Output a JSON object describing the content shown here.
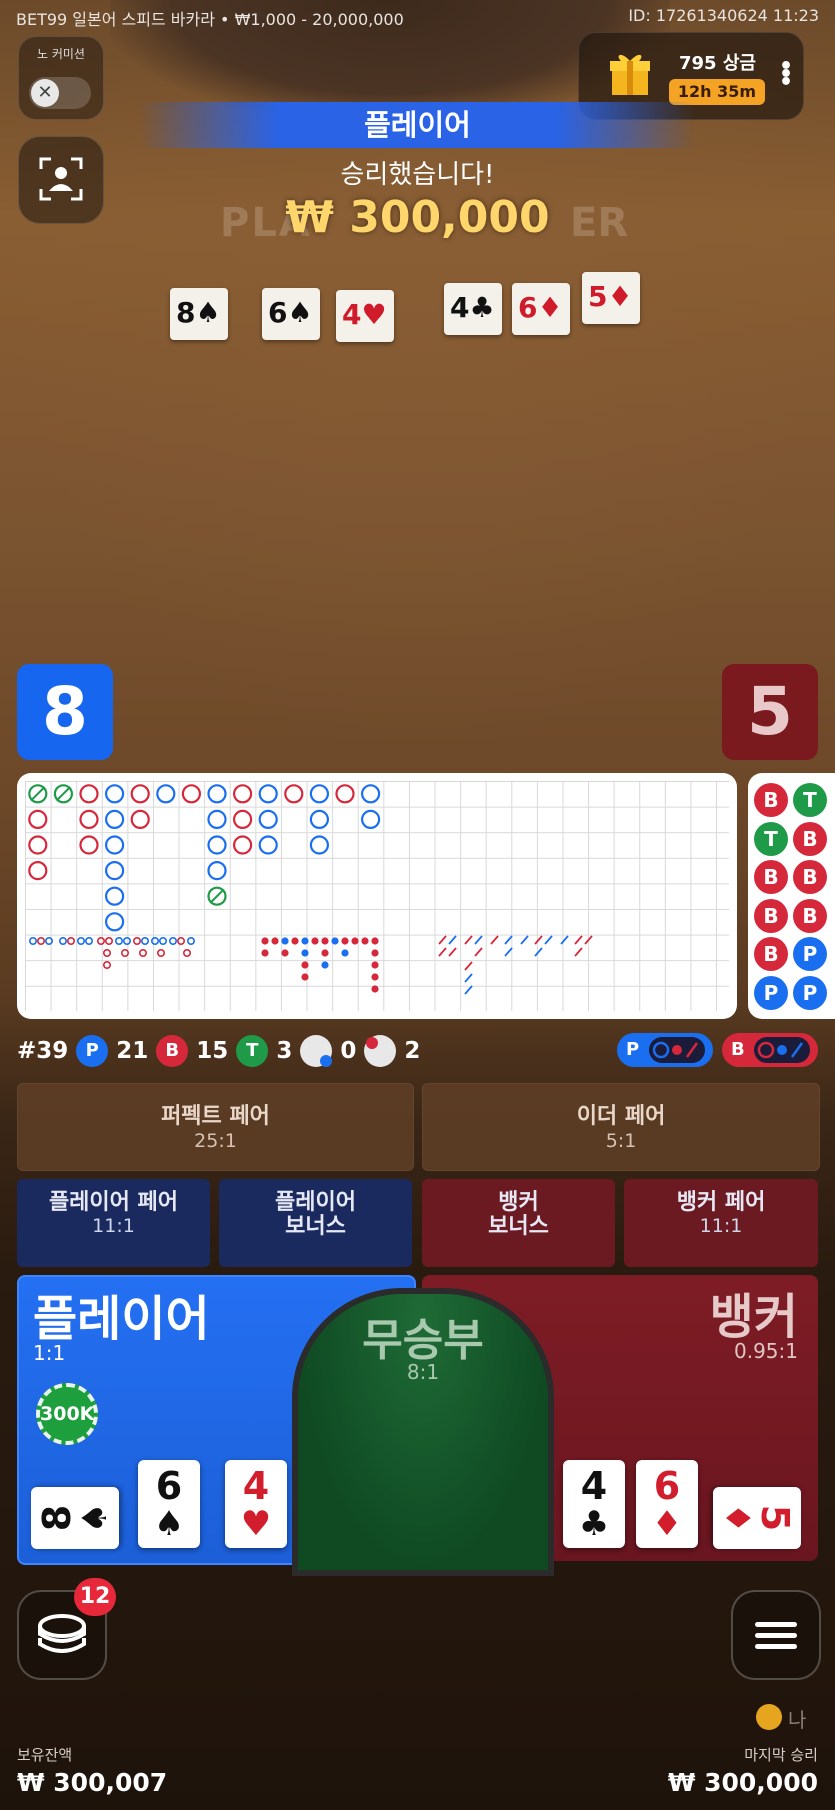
{
  "header": {
    "info": "BET99 일본어 스피드 바카라 • ₩1,000 - 20,000,000",
    "id_time": "ID: 17261340624 11:23"
  },
  "no_commission": {
    "label": "노 커미션"
  },
  "promo": {
    "amount": "795 상금",
    "timer": "12h 35m"
  },
  "result": {
    "banner": "플레이어",
    "subtitle": "승리했습니다!",
    "amount": "₩ 300,000",
    "ghost_left": "PLA",
    "ghost_right": "ER"
  },
  "table_cards": [
    {
      "rank": "8",
      "suit": "♠",
      "color": "#111111"
    },
    {
      "rank": "6",
      "suit": "♠",
      "color": "#111111"
    },
    {
      "rank": "4",
      "suit": "♥",
      "color": "#d01b2b"
    },
    {
      "rank": "4",
      "suit": "♣",
      "color": "#111111"
    },
    {
      "rank": "6",
      "suit": "♦",
      "color": "#d01b2b"
    },
    {
      "rank": "5",
      "suit": "♦",
      "color": "#d01b2b"
    }
  ],
  "scores": {
    "player": "8",
    "banker": "5"
  },
  "stats": {
    "round": "#39",
    "player_letter": "P",
    "player": "21",
    "banker_letter": "B",
    "banker": "15",
    "tie_letter": "T",
    "tie": "3",
    "player_pair": "0",
    "banker_pair": "2"
  },
  "predict": {
    "player": "P",
    "banker": "B"
  },
  "side_road": [
    "B",
    "T",
    "T",
    "B",
    "B",
    "B",
    "B",
    "B",
    "B",
    "P",
    "P",
    "P"
  ],
  "bets": {
    "perfect_pair": {
      "label": "퍼펙트 페어",
      "odds": "25:1"
    },
    "either_pair": {
      "label": "이더 페어",
      "odds": "5:1"
    },
    "player_pair": {
      "label": "플레이어 페어",
      "odds": "11:1"
    },
    "player_bonus": {
      "label1": "플레이어",
      "label2": "보너스"
    },
    "banker_bonus": {
      "label1": "뱅커",
      "label2": "보너스"
    },
    "banker_pair": {
      "label": "뱅커 페어",
      "odds": "11:1"
    },
    "player": {
      "label": "플레이어",
      "odds": "1:1",
      "chip": "300K"
    },
    "tie": {
      "label": "무승부",
      "odds": "8:1"
    },
    "banker": {
      "label": "뱅커",
      "odds": "0.95:1"
    }
  },
  "player_cards": [
    {
      "rank": "8",
      "suit": "♠",
      "color": "#111111"
    },
    {
      "rank": "6",
      "suit": "♠",
      "color": "#111111"
    },
    {
      "rank": "4",
      "suit": "♥",
      "color": "#d21d2c"
    }
  ],
  "banker_cards": [
    {
      "rank": "4",
      "suit": "♣",
      "color": "#111111"
    },
    {
      "rank": "6",
      "suit": "♦",
      "color": "#d21d2c"
    },
    {
      "rank": "5",
      "suit": "♦",
      "color": "#d21d2c"
    }
  ],
  "chips_badge": "12",
  "footer": {
    "balance_label": "보유잔액",
    "balance": "₩ 300,007",
    "last_win_label": "마지막 승리",
    "last_win": "₩ 300,000",
    "corner_text": "나"
  },
  "colors": {
    "player": "#1a6ff0",
    "banker": "#d6283b",
    "tie": "#1f9a49"
  }
}
